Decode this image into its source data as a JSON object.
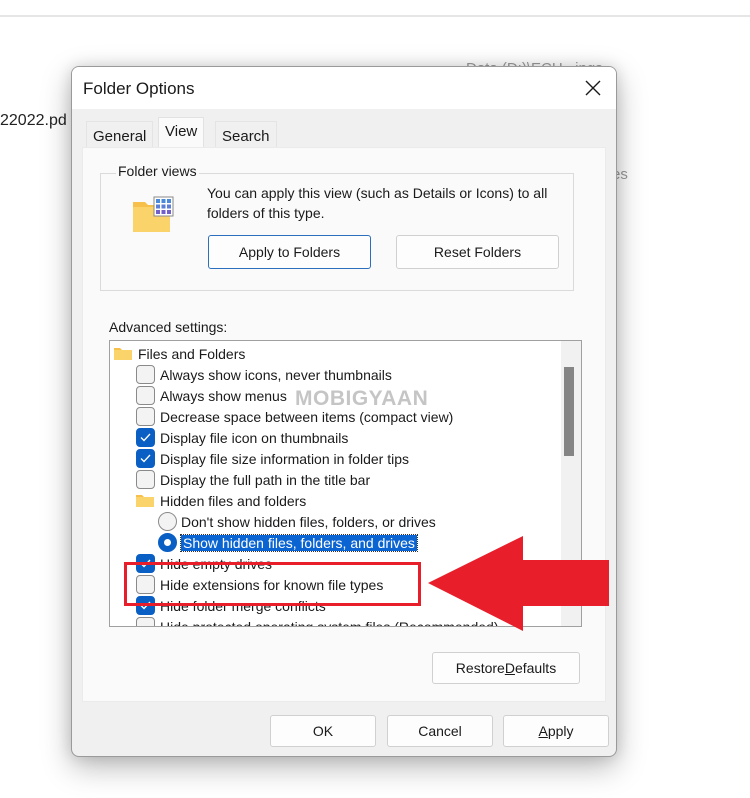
{
  "background": {
    "file_name_fragment": "22022.pd",
    "path_fragment": "Data (D:)\\ECH...ings",
    "path_fragment_2": "es"
  },
  "dialog": {
    "title": "Folder Options",
    "close_icon": "close-icon",
    "tabs": [
      {
        "label": "General",
        "active": false
      },
      {
        "label": "View",
        "active": true
      },
      {
        "label": "Search",
        "active": false
      }
    ],
    "folder_views": {
      "label": "Folder views",
      "icon": "folder-view-icon",
      "description": "You can apply this view (such as Details or Icons) to all folders of this type.",
      "apply_button": {
        "label": "Apply to Folders",
        "mnemonic": "l"
      },
      "reset_button": {
        "label": "Reset Folders",
        "mnemonic": "R"
      }
    },
    "advanced": {
      "label": "Advanced settings:",
      "items": [
        {
          "type": "folder",
          "label": "Files and Folders",
          "level": 0
        },
        {
          "type": "checkbox",
          "label": "Always show icons, never thumbnails",
          "checked": false,
          "level": 1
        },
        {
          "type": "checkbox",
          "label": "Always show menus",
          "checked": false,
          "level": 1
        },
        {
          "type": "checkbox",
          "label": "Decrease space between items (compact view)",
          "checked": false,
          "level": 1
        },
        {
          "type": "checkbox",
          "label": "Display file icon on thumbnails",
          "checked": true,
          "level": 1
        },
        {
          "type": "checkbox",
          "label": "Display file size information in folder tips",
          "checked": true,
          "level": 1
        },
        {
          "type": "checkbox",
          "label": "Display the full path in the title bar",
          "checked": false,
          "level": 1
        },
        {
          "type": "folder",
          "label": "Hidden files and folders",
          "level": 1
        },
        {
          "type": "radio",
          "label": "Don't show hidden files, folders, or drives",
          "selected": false,
          "level": 2
        },
        {
          "type": "radio",
          "label": "Show hidden files, folders, and drives",
          "selected": true,
          "highlighted": true,
          "level": 2
        },
        {
          "type": "checkbox",
          "label": "Hide empty drives",
          "checked": true,
          "level": 1
        },
        {
          "type": "checkbox",
          "label": "Hide extensions for known file types",
          "checked": false,
          "level": 1
        },
        {
          "type": "checkbox",
          "label": "Hide folder merge conflicts",
          "checked": true,
          "level": 1
        },
        {
          "type": "checkbox",
          "label": "Hide protected operating system files (Recommended)",
          "checked": false,
          "level": 1
        }
      ]
    },
    "restore_defaults": {
      "label_pre": "Restore ",
      "mnemonic": "D",
      "label_post": "efaults"
    },
    "footer": {
      "ok": "OK",
      "cancel": "Cancel",
      "apply_mnemonic": "A",
      "apply_rest": "pply"
    }
  },
  "annotation": {
    "watermark": "MOBIGYAAN",
    "highlight_target": "Hide extensions for known file types",
    "color": "#e81f2a"
  },
  "colors": {
    "accent": "#0a5fc4",
    "selection": "#0a64d2",
    "dialog_bg": "#f0f0f0",
    "panel_bg": "#fafafa"
  }
}
